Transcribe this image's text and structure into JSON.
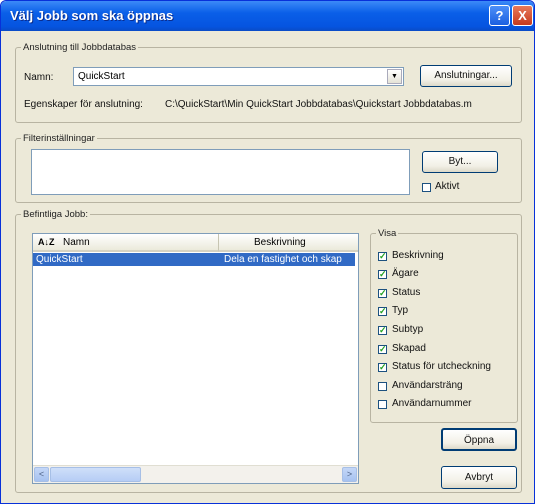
{
  "window": {
    "title": "Välj Jobb som ska öppnas",
    "help_button": "?",
    "close_button": "X"
  },
  "connection": {
    "group_label": "Anslutning till Jobbdatabas",
    "name_label": "Namn:",
    "name_value": "QuickStart",
    "dropdown_arrow": "▼",
    "connections_button": "Anslutningar...",
    "properties_label": "Egenskaper för anslutning:",
    "properties_value": "C:\\QuickStart\\Min QuickStart Jobbdatabas\\Quickstart Jobbdatabas.m"
  },
  "filter": {
    "group_label": "Filterinställningar",
    "change_button": "Byt...",
    "active_label": "Aktivt",
    "active_checked": false
  },
  "jobs": {
    "group_label": "Befintliga Jobb:",
    "sort_icon_text": "A↓Z",
    "columns": [
      "Namn",
      "Beskrivning"
    ],
    "rows": [
      {
        "name": "QuickStart",
        "description": "Dela en fastighet och skap"
      }
    ],
    "scroll_left": "<",
    "scroll_right": ">"
  },
  "view": {
    "group_label": "Visa",
    "options": [
      {
        "label": "Beskrivning",
        "checked": true
      },
      {
        "label": "Ägare",
        "checked": true
      },
      {
        "label": "Status",
        "checked": true
      },
      {
        "label": "Typ",
        "checked": true
      },
      {
        "label": "Subtyp",
        "checked": true
      },
      {
        "label": "Skapad",
        "checked": true
      },
      {
        "label": "Status för utcheckning",
        "checked": true
      },
      {
        "label": "Användarsträng",
        "checked": false
      },
      {
        "label": "Användarnummer",
        "checked": false
      }
    ]
  },
  "actions": {
    "open_button": "Öppna",
    "cancel_button": "Avbryt"
  },
  "colors": {
    "titlebar": "#0554e0",
    "selection": "#316ac5",
    "dialog_bg": "#ece9d8"
  }
}
